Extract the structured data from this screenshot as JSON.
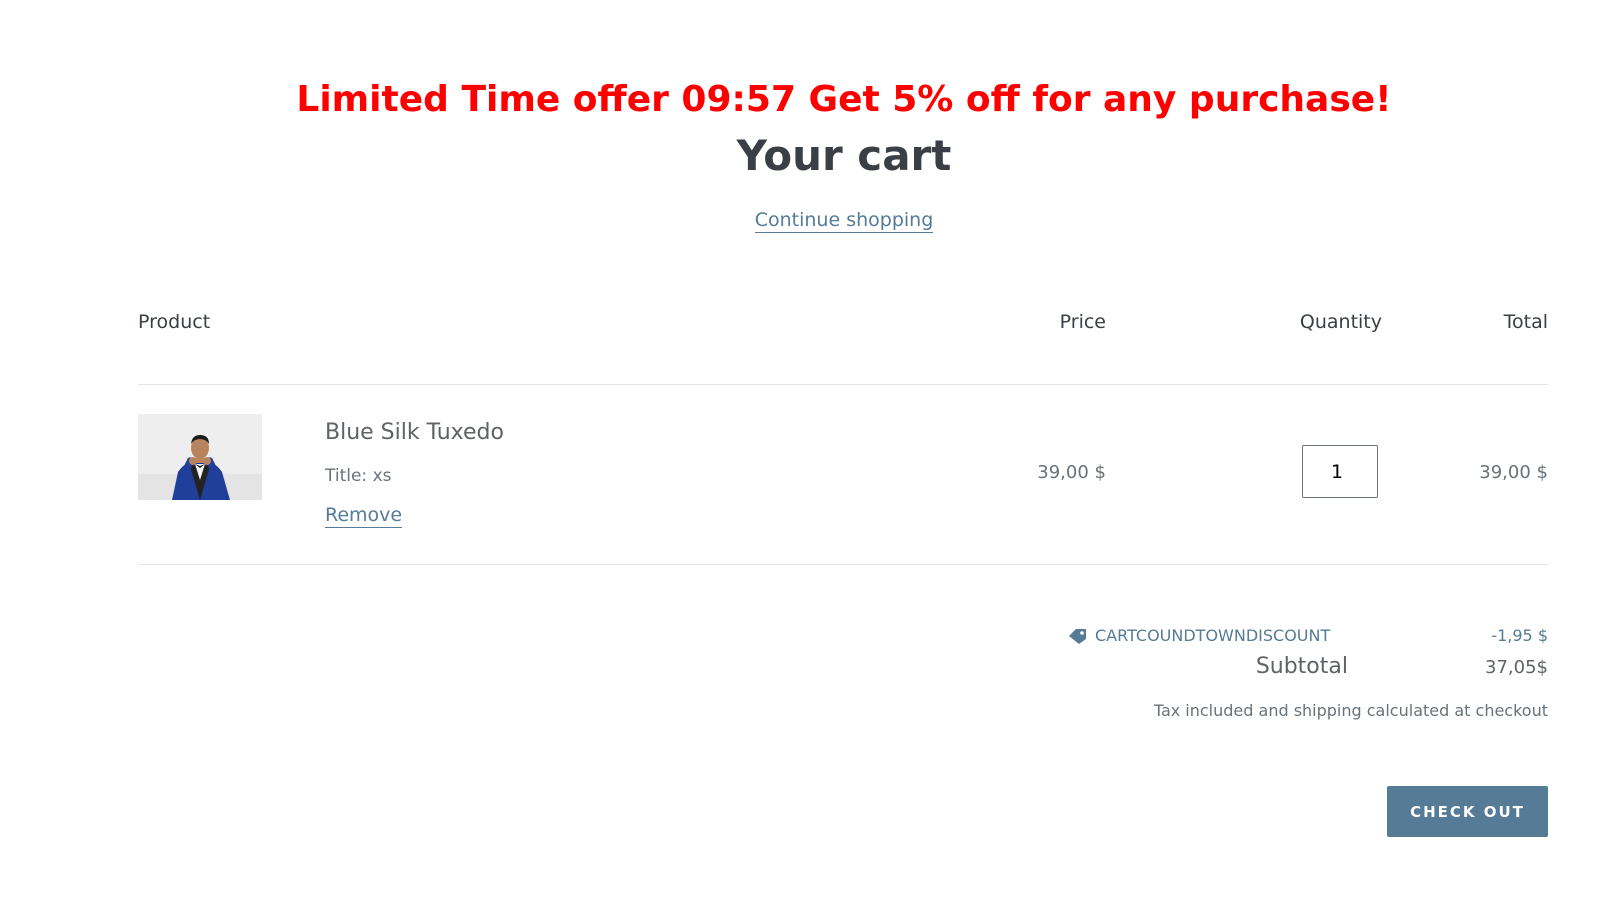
{
  "promo": {
    "text": "Limited Time offer 09:57 Get 5% off for any purchase!",
    "color": "#ff0000"
  },
  "cart": {
    "title": "Your cart",
    "continue_label": "Continue shopping"
  },
  "table": {
    "headers": {
      "product": "Product",
      "price": "Price",
      "quantity": "Quantity",
      "total": "Total"
    },
    "rows": [
      {
        "image": "product-photo",
        "name": "Blue Silk Tuxedo",
        "variant": "Title: xs",
        "remove_label": "Remove",
        "price": "39,00 $",
        "quantity": "1",
        "total": "39,00 $"
      }
    ]
  },
  "summary": {
    "discount_icon": "tag-icon",
    "discount_code": "CARTCOUNDTOWNDISCOUNT",
    "discount_amount": "-1,95 $",
    "subtotal_label": "Subtotal",
    "subtotal_value": "37,05$",
    "tax_note": "Tax included and shipping calculated at checkout"
  },
  "checkout": {
    "label": "CHECK OUT"
  },
  "colors": {
    "accent": "#557b97",
    "text": "#3a3f45",
    "muted": "#69727b",
    "promo": "#ff0000",
    "divider": "#e6e6e6"
  }
}
